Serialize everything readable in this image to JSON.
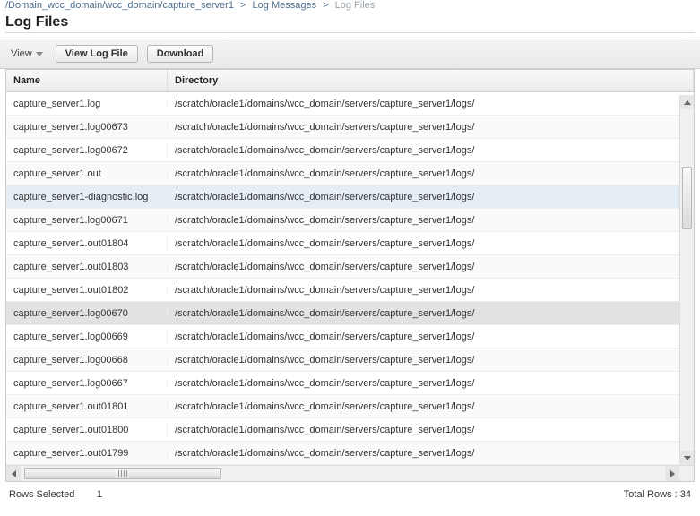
{
  "breadcrumb": {
    "parts": [
      "/Domain_wcc_domain/wcc_domain/capture_server1",
      "Log Messages",
      "Log Files"
    ]
  },
  "page": {
    "title": "Log Files"
  },
  "toolbar": {
    "view_label": "View",
    "view_log_file_label": "View Log File",
    "download_label": "Download"
  },
  "table": {
    "headers": {
      "name": "Name",
      "directory": "Directory"
    },
    "rows": [
      {
        "name": "capture_server1.log",
        "dir": "/scratch/oracle1/domains/wcc_domain/servers/capture_server1/logs/",
        "state": ""
      },
      {
        "name": "capture_server1.log00673",
        "dir": "/scratch/oracle1/domains/wcc_domain/servers/capture_server1/logs/",
        "state": ""
      },
      {
        "name": "capture_server1.log00672",
        "dir": "/scratch/oracle1/domains/wcc_domain/servers/capture_server1/logs/",
        "state": ""
      },
      {
        "name": "capture_server1.out",
        "dir": "/scratch/oracle1/domains/wcc_domain/servers/capture_server1/logs/",
        "state": ""
      },
      {
        "name": "capture_server1-diagnostic.log",
        "dir": "/scratch/oracle1/domains/wcc_domain/servers/capture_server1/logs/",
        "state": "sel"
      },
      {
        "name": "capture_server1.log00671",
        "dir": "/scratch/oracle1/domains/wcc_domain/servers/capture_server1/logs/",
        "state": ""
      },
      {
        "name": "capture_server1.out01804",
        "dir": "/scratch/oracle1/domains/wcc_domain/servers/capture_server1/logs/",
        "state": ""
      },
      {
        "name": "capture_server1.out01803",
        "dir": "/scratch/oracle1/domains/wcc_domain/servers/capture_server1/logs/",
        "state": ""
      },
      {
        "name": "capture_server1.out01802",
        "dir": "/scratch/oracle1/domains/wcc_domain/servers/capture_server1/logs/",
        "state": ""
      },
      {
        "name": "capture_server1.log00670",
        "dir": "/scratch/oracle1/domains/wcc_domain/servers/capture_server1/logs/",
        "state": "sel2"
      },
      {
        "name": "capture_server1.log00669",
        "dir": "/scratch/oracle1/domains/wcc_domain/servers/capture_server1/logs/",
        "state": ""
      },
      {
        "name": "capture_server1.log00668",
        "dir": "/scratch/oracle1/domains/wcc_domain/servers/capture_server1/logs/",
        "state": ""
      },
      {
        "name": "capture_server1.log00667",
        "dir": "/scratch/oracle1/domains/wcc_domain/servers/capture_server1/logs/",
        "state": ""
      },
      {
        "name": "capture_server1.out01801",
        "dir": "/scratch/oracle1/domains/wcc_domain/servers/capture_server1/logs/",
        "state": ""
      },
      {
        "name": "capture_server1.out01800",
        "dir": "/scratch/oracle1/domains/wcc_domain/servers/capture_server1/logs/",
        "state": ""
      },
      {
        "name": "capture_server1.out01799",
        "dir": "/scratch/oracle1/domains/wcc_domain/servers/capture_server1/logs/",
        "state": ""
      }
    ],
    "total_rows": 34
  },
  "footer": {
    "rows_selected_label": "Rows Selected",
    "rows_selected_count": "1",
    "total_rows_label": "Total Rows :",
    "total_rows_value": "34"
  }
}
